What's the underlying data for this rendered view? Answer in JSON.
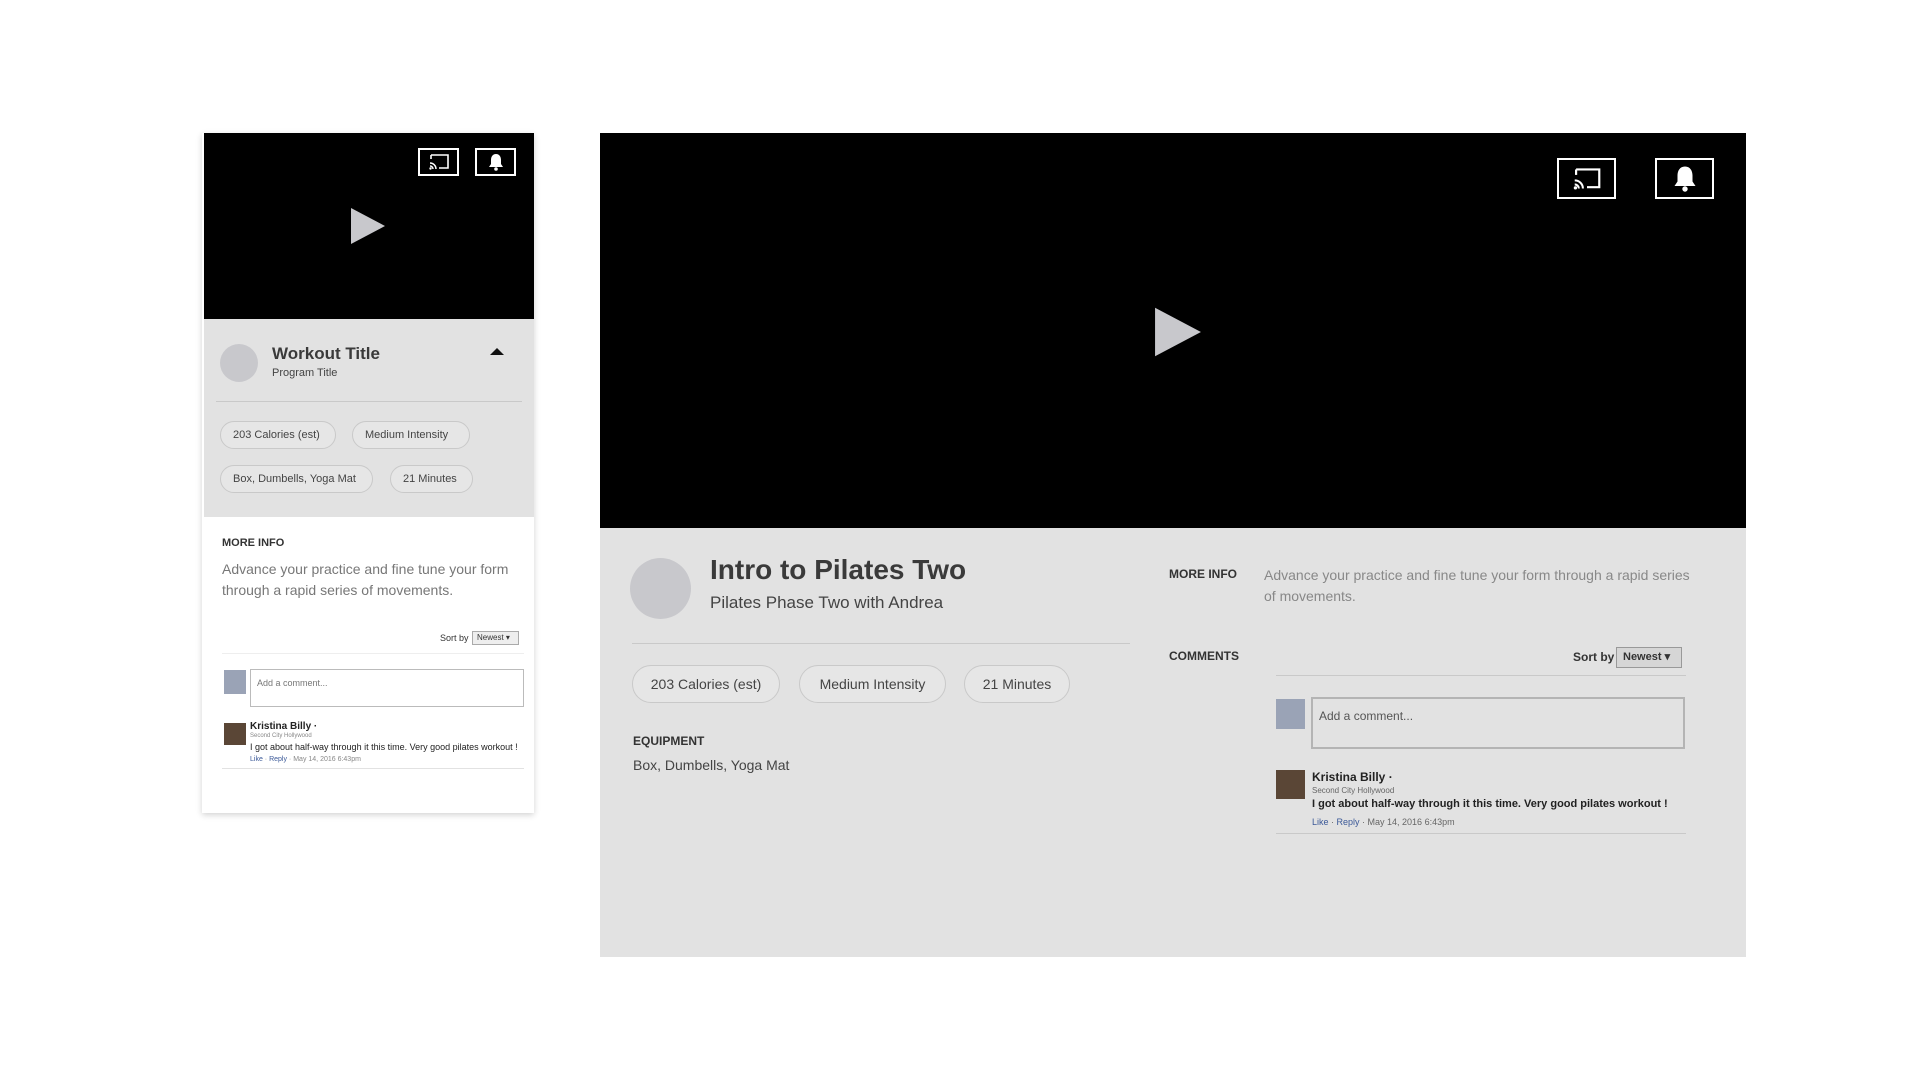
{
  "mobile": {
    "workout_title": "Workout Title",
    "program_title": "Program Title",
    "tags": [
      "203 Calories (est)",
      "Medium Intensity",
      "Box, Dumbells, Yoga Mat",
      "21 Minutes"
    ],
    "more_info_label": "MORE INFO",
    "more_info_text": "Advance your practice and fine tune your form through a rapid series of movements.",
    "sort_by_label": "Sort by",
    "sort_value": "Newest ▾",
    "comment_placeholder": "Add a comment...",
    "comment": {
      "author": "Kristina Billy ·",
      "location": "Second City Hollywood",
      "text": "I got about half-way through it this time. Very good pilates workout !",
      "like": "Like",
      "reply": "Reply",
      "sep1": " · ",
      "sep2": " · ",
      "date": "May 14, 2016 6:43pm"
    }
  },
  "desktop": {
    "workout_title": "Intro to Pilates Two",
    "program_title": "Pilates Phase Two with Andrea",
    "tags": [
      "203 Calories (est)",
      "Medium Intensity",
      "21 Minutes"
    ],
    "equipment_label": "EQUIPMENT",
    "equipment_text": "Box, Dumbells, Yoga Mat",
    "more_info_label": "MORE INFO",
    "more_info_text": "Advance your practice and fine tune your form through a rapid series of movements.",
    "comments_label": "COMMENTS",
    "sort_by_label": "Sort by",
    "sort_value": "Newest ▾",
    "comment_placeholder": "Add a comment...",
    "comment": {
      "author": "Kristina Billy ·",
      "location": "Second City Hollywood",
      "text": "I got about half-way through it this time. Very good pilates workout !",
      "like": "Like",
      "reply": "Reply",
      "sep1": " · ",
      "sep2": " · ",
      "date": "May 14, 2016 6:43pm"
    }
  },
  "icons": {
    "cast": "cast-icon",
    "bell": "bell-icon",
    "play": "play-icon",
    "collapse": "chevron-up-icon"
  },
  "colors": {
    "video_bg": "#000000",
    "panel_bg": "#e2e2e2",
    "avatar": "#c8c8cc",
    "link": "#3b5998"
  }
}
